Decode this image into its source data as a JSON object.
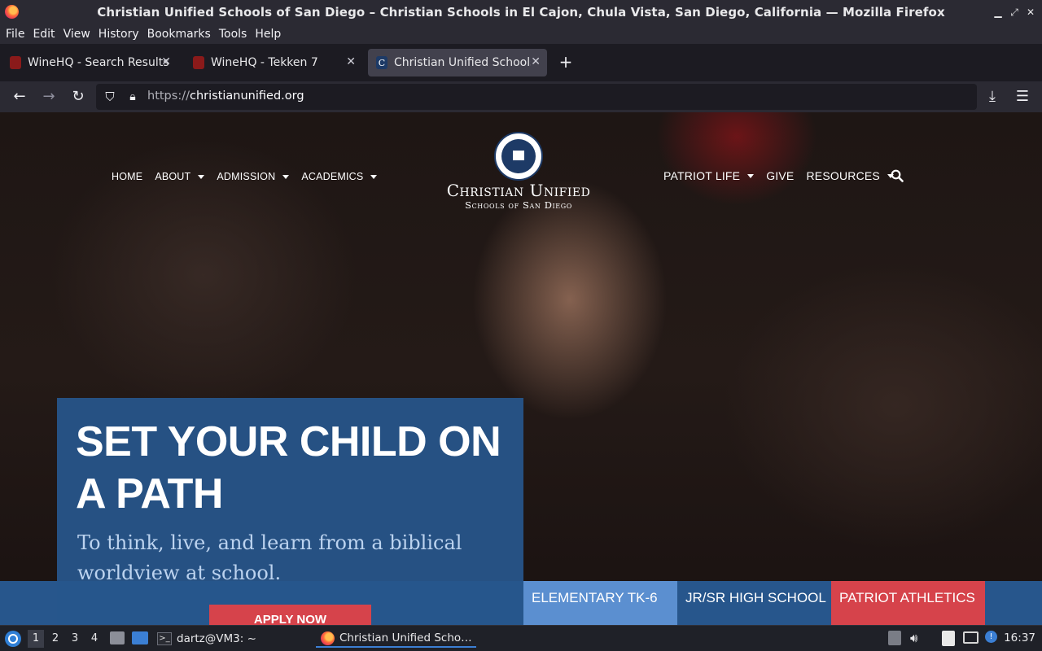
{
  "window": {
    "title": "Christian Unified Schools of San Diego – Christian Schools in El Cajon, Chula Vista, San Diego, California — Mozilla Firefox"
  },
  "menu": [
    "File",
    "Edit",
    "View",
    "History",
    "Bookmarks",
    "Tools",
    "Help"
  ],
  "tabs": [
    {
      "label": "WineHQ - Search Results",
      "active": false
    },
    {
      "label": "WineHQ - Tekken 7",
      "active": false
    },
    {
      "label": "Christian Unified Schools",
      "active": true
    }
  ],
  "address": {
    "protocol": "https://",
    "domain": "christianunified.org"
  },
  "site": {
    "nav_left": [
      "HOME",
      "ABOUT",
      "ADMISSION",
      "ACADEMICS"
    ],
    "nav_right": [
      "PATRIOT LIFE",
      "GIVE",
      "RESOURCES"
    ],
    "logo_name": "Christian Unified",
    "logo_sub": "Schools of San Diego",
    "hero_heading": "SET YOUR CHILD ON A PATH",
    "hero_text": "To think, live, and learn from a biblical worldview at school.",
    "apply_label": "APPLY NOW",
    "quick_links": [
      {
        "label": "ELEMENTARY TK-6",
        "color": "#5b8fd0"
      },
      {
        "label": "JR/SR HIGH SCHOOL",
        "color": "#27568c"
      },
      {
        "label": "PATRIOT ATHLETICS",
        "color": "#d6434b"
      }
    ]
  },
  "taskbar": {
    "workspaces": [
      "1",
      "2",
      "3",
      "4"
    ],
    "terminal_label": "dartz@VM3: ~",
    "firefox_label": "Christian Unified Scho…",
    "clock": "16:37"
  }
}
